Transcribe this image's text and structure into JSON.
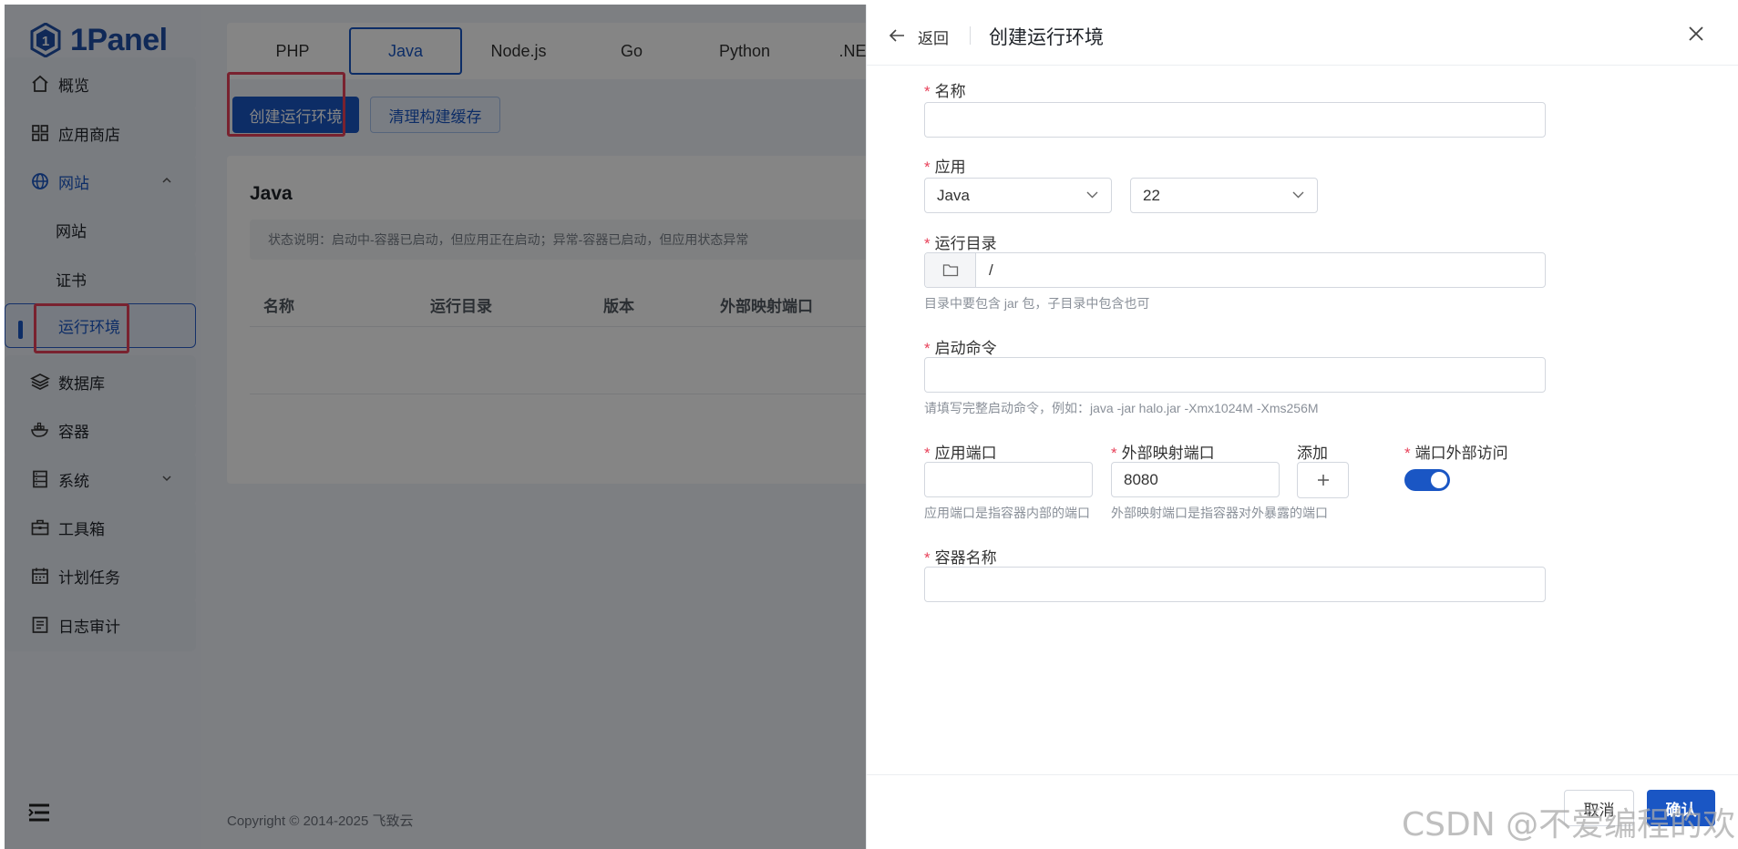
{
  "brand": {
    "name": "1Panel"
  },
  "sidebar": {
    "items": [
      {
        "label": "概览"
      },
      {
        "label": "应用商店"
      },
      {
        "label": "网站"
      },
      {
        "label": "网站"
      },
      {
        "label": "证书"
      },
      {
        "label": "运行环境"
      },
      {
        "label": "数据库"
      },
      {
        "label": "容器"
      },
      {
        "label": "系统"
      },
      {
        "label": "工具箱"
      },
      {
        "label": "计划任务"
      },
      {
        "label": "日志审计"
      }
    ]
  },
  "main": {
    "tabs": [
      {
        "label": "PHP"
      },
      {
        "label": "Java"
      },
      {
        "label": "Node.js"
      },
      {
        "label": "Go"
      },
      {
        "label": "Python"
      },
      {
        "label": ".NET"
      }
    ],
    "create_button": "创建运行环境",
    "clear_cache_button": "清理构建缓存",
    "heading": "Java",
    "status_note": "状态说明：启动中-容器已启动，但应用正在启动；异常-容器已启动，但应用状态异常",
    "table_columns": [
      "名称",
      "运行目录",
      "版本",
      "外部映射端口"
    ],
    "footer": "Copyright © 2014-2025 飞致云"
  },
  "drawer": {
    "back": "返回",
    "title": "创建运行环境",
    "fields": {
      "name_label": "名称",
      "name_value": "",
      "app_label": "应用",
      "app_value": "Java",
      "app_version_value": "22",
      "dir_label": "运行目录",
      "dir_value": "/",
      "dir_hint": "目录中要包含 jar 包，子目录中包含也可",
      "cmd_label": "启动命令",
      "cmd_value": "",
      "cmd_hint": "请填写完整启动命令，例如：java -jar halo.jar -Xmx1024M -Xms256M",
      "app_port_label": "应用端口",
      "app_port_value": "",
      "app_port_hint": "应用端口是指容器内部的端口",
      "ext_port_label": "外部映射端口",
      "ext_port_value": "8080",
      "ext_port_hint": "外部映射端口是指容器对外暴露的端口",
      "add_label": "添加",
      "ext_access_label": "端口外部访问",
      "ext_access_on": true,
      "container_label": "容器名称",
      "container_value": ""
    },
    "cancel": "取消",
    "confirm": "确认"
  },
  "watermark": "CSDN @不爱编程的欢",
  "colors": {
    "accent": "#1a56c4",
    "highlight": "#e8425a",
    "required": "#e8425a"
  }
}
